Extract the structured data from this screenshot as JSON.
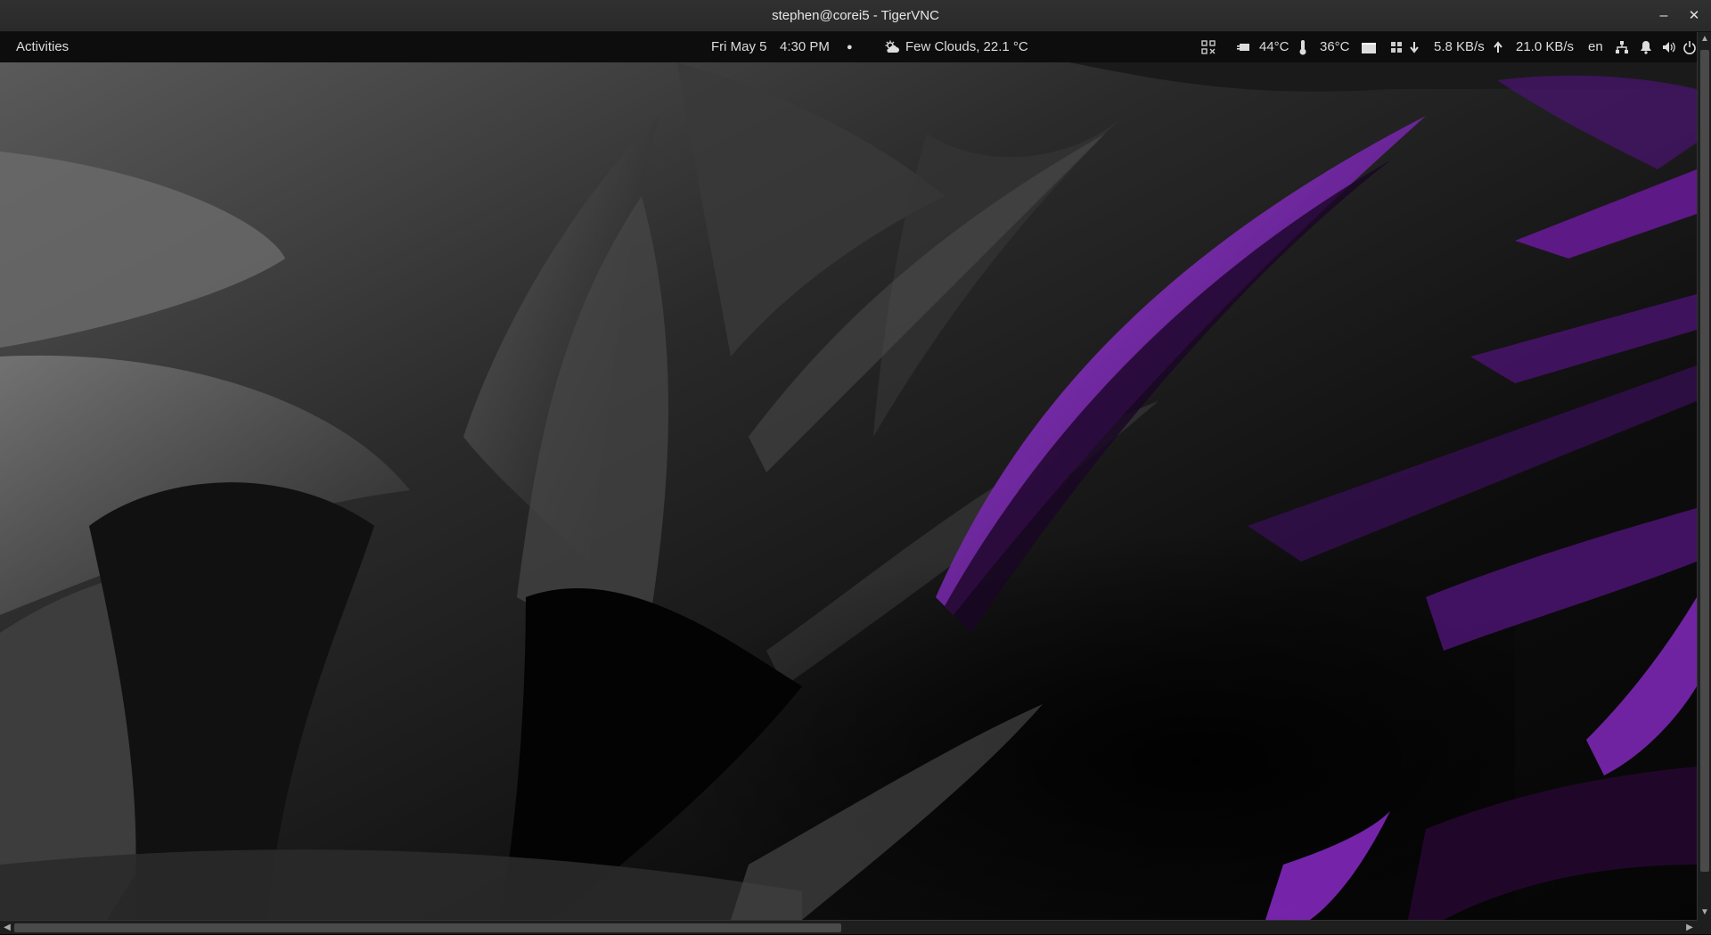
{
  "window": {
    "title": "stephen@corei5 - TigerVNC",
    "minimize_glyph": "–",
    "close_glyph": "✕"
  },
  "panel": {
    "activities": "Activities",
    "date": "Fri May 5",
    "time": "4:30 PM",
    "notification_dot": "●",
    "weather": "Few Clouds, 22.1 °C",
    "cpu_temp": "44°C",
    "gpu_temp": "36°C",
    "download_speed": "5.8 KB/s",
    "upload_speed": "21.0 KB/s",
    "keyboard_layout": "en",
    "icons": [
      "qr-code-icon",
      "cpu-chip-icon",
      "thermometer-icon",
      "folder-icon",
      "workspace-grid-icon",
      "download-arrow-icon",
      "upload-arrow-icon",
      "network-icon",
      "notification-bell-icon",
      "volume-icon",
      "power-icon"
    ]
  },
  "colors": {
    "accent_purple": "#7a1fb0",
    "panel_bg": "#0d0d0d",
    "titlebar_bg": "#2d2d2d"
  }
}
